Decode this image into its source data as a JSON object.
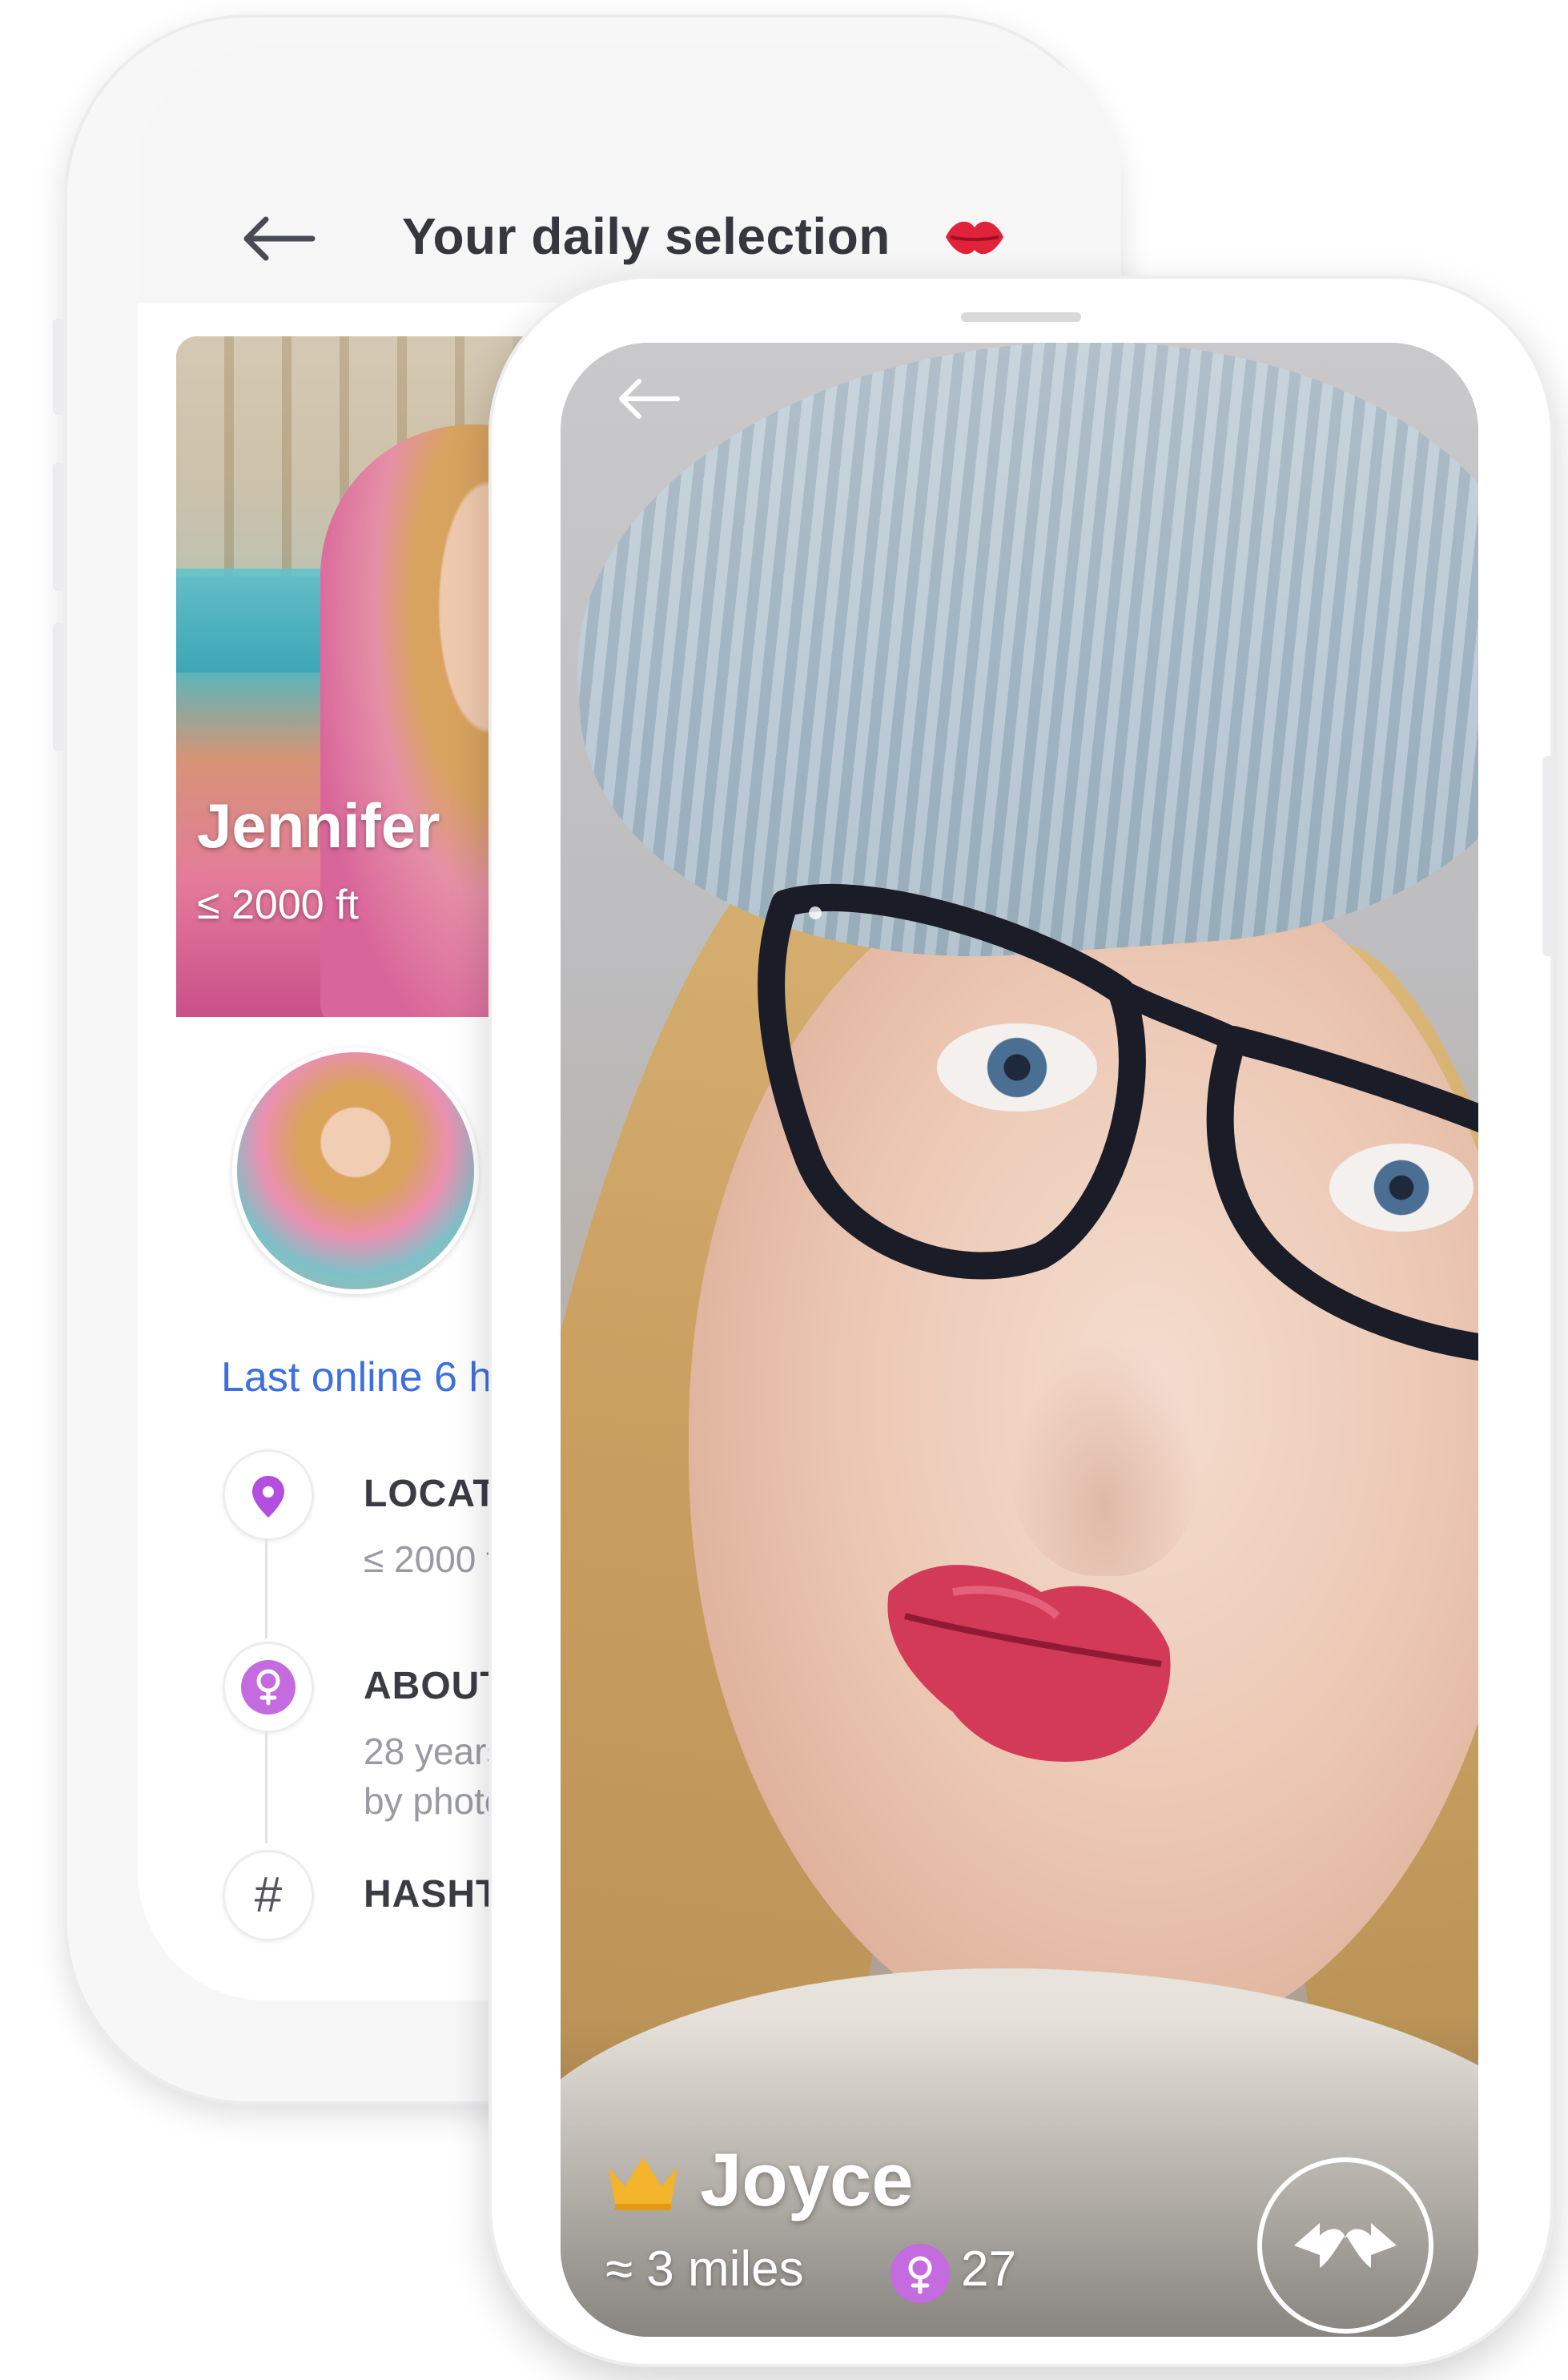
{
  "back_screen": {
    "title": "Your daily selection",
    "card": {
      "name": "Jennifer",
      "distance": "≤ 2000 ft"
    },
    "last_online": "Last online 6 h",
    "sections": [
      {
        "label": "LOCATION",
        "detail": "≤ 2000 ft",
        "icon": "location-pin-icon"
      },
      {
        "label": "ABOUT",
        "detail_line1": "28 years",
        "detail_line2": "by photo",
        "icon": "female-gender-icon"
      },
      {
        "label": "HASHTAGS",
        "icon": "hashtag-icon"
      }
    ]
  },
  "front_screen": {
    "name": "Joyce",
    "distance": "≈ 3 miles",
    "age": "27",
    "badge_icon": "crown-icon",
    "gender_icon": "female-gender-icon",
    "action_icon": "swap-hearts-icon"
  },
  "colors": {
    "accent_purple": "#b44ee0",
    "link_blue": "#3d6fe0",
    "kiss_red": "#e0233a",
    "crown_gold": "#f3b32a"
  }
}
